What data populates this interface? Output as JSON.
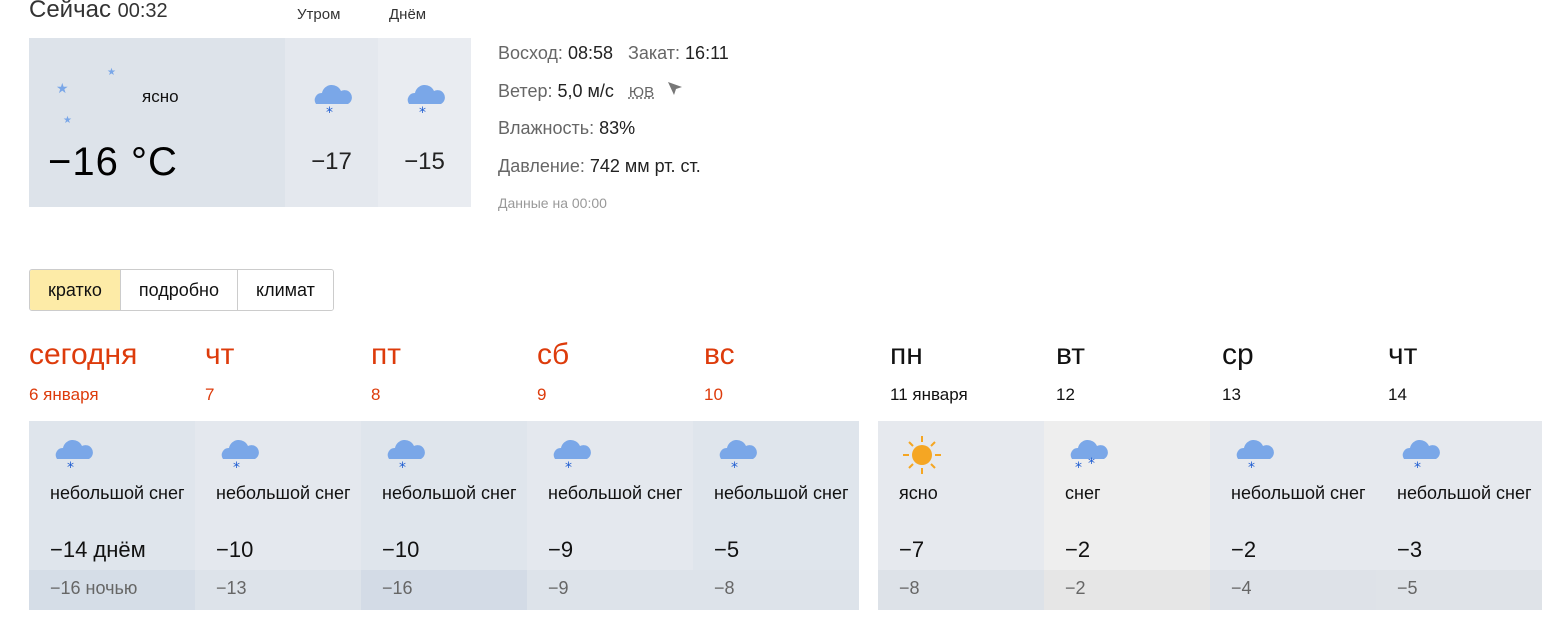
{
  "current": {
    "title_prefix": "Сейчас",
    "time": "00:32",
    "condition": "ясно",
    "temp": "−16 °C",
    "condition_icon": "moon-stars-icon",
    "morning": {
      "label": "Утром",
      "temp": "−17",
      "icon": "light-snow-icon"
    },
    "day": {
      "label": "Днём",
      "temp": "−15",
      "icon": "light-snow-icon"
    }
  },
  "details": {
    "sunrise_label": "Восход:",
    "sunrise": "08:58",
    "sunset_label": "Закат:",
    "sunset": "16:11",
    "wind_label": "Ветер:",
    "wind": "5,0 м/с",
    "wind_dir": "ЮВ",
    "humidity_label": "Влажность:",
    "humidity": "83%",
    "pressure_label": "Давление:",
    "pressure": "742 мм рт. ст.",
    "data_time": "Данные на 00:00"
  },
  "tabs": [
    {
      "label": "кратко",
      "active": true
    },
    {
      "label": "подробно",
      "active": false
    },
    {
      "label": "климат",
      "active": false
    }
  ],
  "forecast": [
    {
      "name": "сегодня",
      "date": "6 января",
      "weekend": true,
      "cond": "небольшой снег",
      "icon": "light-snow-icon",
      "day": "−14 днём",
      "night": "−16 ночью"
    },
    {
      "name": "чт",
      "date": "7",
      "weekend": true,
      "cond": "небольшой снег",
      "icon": "light-snow-icon",
      "day": "−10",
      "night": "−13"
    },
    {
      "name": "пт",
      "date": "8",
      "weekend": true,
      "cond": "небольшой снег",
      "icon": "light-snow-icon",
      "day": "−10",
      "night": "−16"
    },
    {
      "name": "сб",
      "date": "9",
      "weekend": true,
      "cond": "небольшой снег",
      "icon": "light-snow-icon",
      "day": "−9",
      "night": "−9"
    },
    {
      "name": "вс",
      "date": "10",
      "weekend": true,
      "cond": "небольшой снег",
      "icon": "light-snow-icon",
      "day": "−5",
      "night": "−8"
    },
    {
      "name": "пн",
      "date": "11 января",
      "weekend": false,
      "cond": "ясно",
      "icon": "sun-icon",
      "day": "−7",
      "night": "−8"
    },
    {
      "name": "вт",
      "date": "12",
      "weekend": false,
      "cond": "снег",
      "icon": "snow-icon",
      "day": "−2",
      "night": "−2"
    },
    {
      "name": "ср",
      "date": "13",
      "weekend": false,
      "cond": "небольшой снег",
      "icon": "light-snow-icon",
      "day": "−2",
      "night": "−4"
    },
    {
      "name": "чт",
      "date": "14",
      "weekend": false,
      "cond": "небольшой снег",
      "icon": "light-snow-icon",
      "day": "−3",
      "night": "−5"
    }
  ],
  "colors": {
    "weekend": "#dd3b0b",
    "active_tab": "#fdeba7",
    "cloud": "#7aa7e8",
    "snowflake": "#1d5cd1",
    "sun": "#f5a623"
  }
}
